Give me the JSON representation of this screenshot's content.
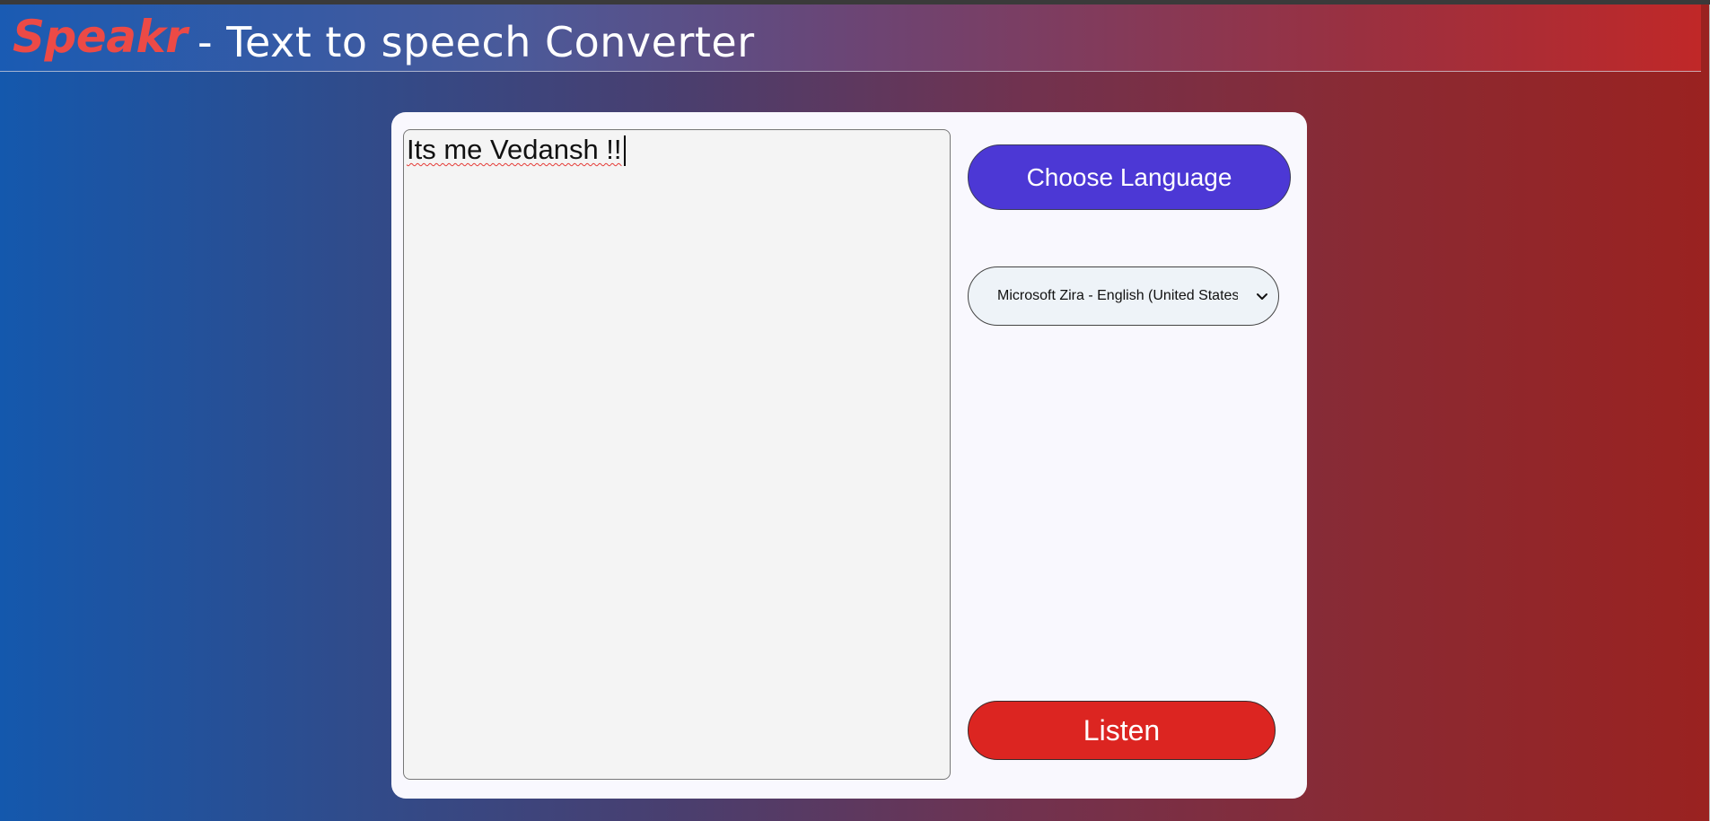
{
  "header": {
    "brand": "Speakr",
    "subtitle": "- Text to speech Converter"
  },
  "editor": {
    "text": "Its me Vedansh !!"
  },
  "controls": {
    "choose_language_label": "Choose Language",
    "voice_selected": "Microsoft Zira - English (United States)",
    "listen_label": "Listen"
  },
  "icons": {
    "select_arrow": "chevron-down-icon"
  },
  "colors": {
    "brand": "#ec4a46",
    "choose_button": "#4c38d5",
    "listen_button": "#dc2521",
    "card": "#f9f8fe",
    "gradient_left": "#1458ad",
    "gradient_right": "#9a2220"
  }
}
